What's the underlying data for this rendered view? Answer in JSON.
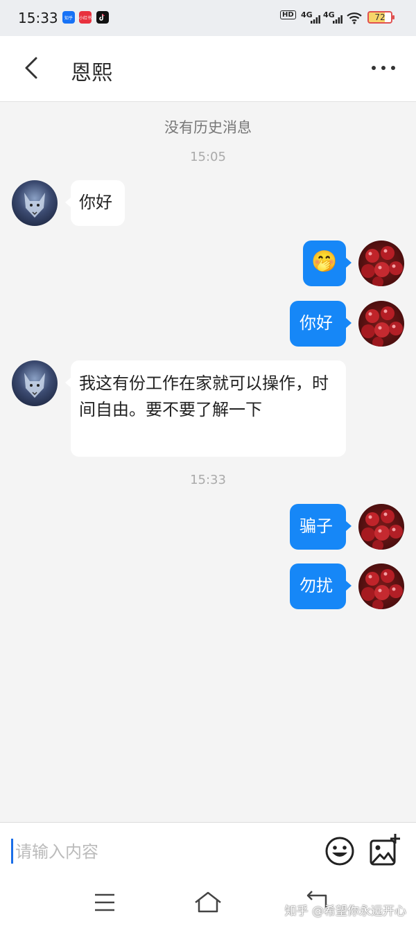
{
  "status": {
    "time": "15:33",
    "apps": [
      {
        "name": "zhihu-app-icon",
        "label": "知乎",
        "color": "#1772f6"
      },
      {
        "name": "xiaohongshu-app-icon",
        "label": "小红书",
        "color": "#e8313e"
      },
      {
        "name": "tiktok-app-icon",
        "label": "",
        "color": "#111111"
      }
    ],
    "hd_label": "HD",
    "network_1": "4G",
    "network_2": "4G",
    "battery": "72"
  },
  "header": {
    "title": "恩熙"
  },
  "chat": {
    "no_history": "没有历史消息",
    "messages": [
      {
        "type": "time",
        "text": "15:05"
      },
      {
        "type": "in",
        "text": "你好"
      },
      {
        "type": "out",
        "text": "🤭"
      },
      {
        "type": "out",
        "text": "你好"
      },
      {
        "type": "in",
        "text": "我这有份工作在家就可以操作，时间自由。要不要了解一下"
      },
      {
        "type": "time",
        "text": "15:33"
      },
      {
        "type": "out",
        "text": "骗子"
      },
      {
        "type": "out",
        "text": "勿扰"
      }
    ]
  },
  "input": {
    "placeholder": "请输入内容",
    "value": ""
  },
  "watermark": "知乎 @希望你永远开心",
  "colors": {
    "accent": "#1687f7",
    "background": "#f4f4f4"
  }
}
